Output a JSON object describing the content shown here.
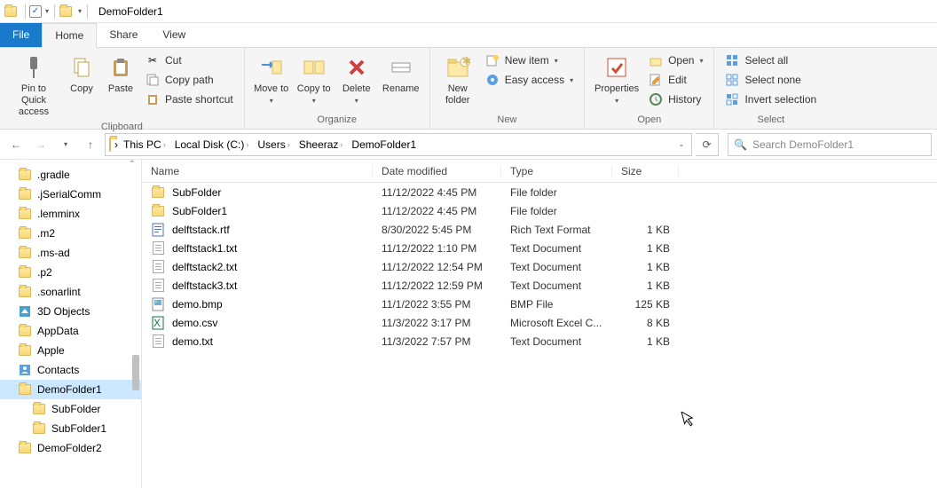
{
  "window": {
    "title": "DemoFolder1"
  },
  "tabs": {
    "file": "File",
    "home": "Home",
    "share": "Share",
    "view": "View"
  },
  "ribbon": {
    "clipboard": {
      "label": "Clipboard",
      "pin": "Pin to Quick access",
      "copy": "Copy",
      "paste": "Paste",
      "cut": "Cut",
      "copy_path": "Copy path",
      "paste_shortcut": "Paste shortcut"
    },
    "organize": {
      "label": "Organize",
      "move_to": "Move to",
      "copy_to": "Copy to",
      "delete": "Delete",
      "rename": "Rename"
    },
    "new": {
      "label": "New",
      "new_folder": "New folder",
      "new_item": "New item",
      "easy_access": "Easy access"
    },
    "open": {
      "label": "Open",
      "properties": "Properties",
      "open": "Open",
      "edit": "Edit",
      "history": "History"
    },
    "select": {
      "label": "Select",
      "select_all": "Select all",
      "select_none": "Select none",
      "invert": "Invert selection"
    }
  },
  "breadcrumb": [
    "This PC",
    "Local Disk (C:)",
    "Users",
    "Sheeraz",
    "DemoFolder1"
  ],
  "search": {
    "placeholder": "Search DemoFolder1"
  },
  "tree": [
    {
      "name": ".gradle",
      "icon": "folder"
    },
    {
      "name": ".jSerialComm",
      "icon": "folder"
    },
    {
      "name": ".lemminx",
      "icon": "folder"
    },
    {
      "name": ".m2",
      "icon": "folder"
    },
    {
      "name": ".ms-ad",
      "icon": "folder"
    },
    {
      "name": ".p2",
      "icon": "folder"
    },
    {
      "name": ".sonarlint",
      "icon": "folder"
    },
    {
      "name": "3D Objects",
      "icon": "3d"
    },
    {
      "name": "AppData",
      "icon": "folder"
    },
    {
      "name": "Apple",
      "icon": "folder"
    },
    {
      "name": "Contacts",
      "icon": "contacts"
    },
    {
      "name": "DemoFolder1",
      "icon": "folder",
      "selected": true
    },
    {
      "name": "SubFolder",
      "icon": "folder",
      "indent": true
    },
    {
      "name": "SubFolder1",
      "icon": "folder",
      "indent": true
    },
    {
      "name": "DemoFolder2",
      "icon": "folder"
    }
  ],
  "columns": {
    "name": "Name",
    "date": "Date modified",
    "type": "Type",
    "size": "Size"
  },
  "files": [
    {
      "name": "SubFolder",
      "date": "11/12/2022 4:45 PM",
      "type": "File folder",
      "size": "",
      "icon": "folder"
    },
    {
      "name": "SubFolder1",
      "date": "11/12/2022 4:45 PM",
      "type": "File folder",
      "size": "",
      "icon": "folder"
    },
    {
      "name": "delftstack.rtf",
      "date": "8/30/2022 5:45 PM",
      "type": "Rich Text Format",
      "size": "1 KB",
      "icon": "rtf"
    },
    {
      "name": "delftstack1.txt",
      "date": "11/12/2022 1:10 PM",
      "type": "Text Document",
      "size": "1 KB",
      "icon": "txt"
    },
    {
      "name": "delftstack2.txt",
      "date": "11/12/2022 12:54 PM",
      "type": "Text Document",
      "size": "1 KB",
      "icon": "txt"
    },
    {
      "name": "delftstack3.txt",
      "date": "11/12/2022 12:59 PM",
      "type": "Text Document",
      "size": "1 KB",
      "icon": "txt"
    },
    {
      "name": "demo.bmp",
      "date": "11/1/2022 3:55 PM",
      "type": "BMP File",
      "size": "125 KB",
      "icon": "bmp"
    },
    {
      "name": "demo.csv",
      "date": "11/3/2022 3:17 PM",
      "type": "Microsoft Excel C...",
      "size": "8 KB",
      "icon": "csv"
    },
    {
      "name": "demo.txt",
      "date": "11/3/2022 7:57 PM",
      "type": "Text Document",
      "size": "1 KB",
      "icon": "txt"
    }
  ]
}
